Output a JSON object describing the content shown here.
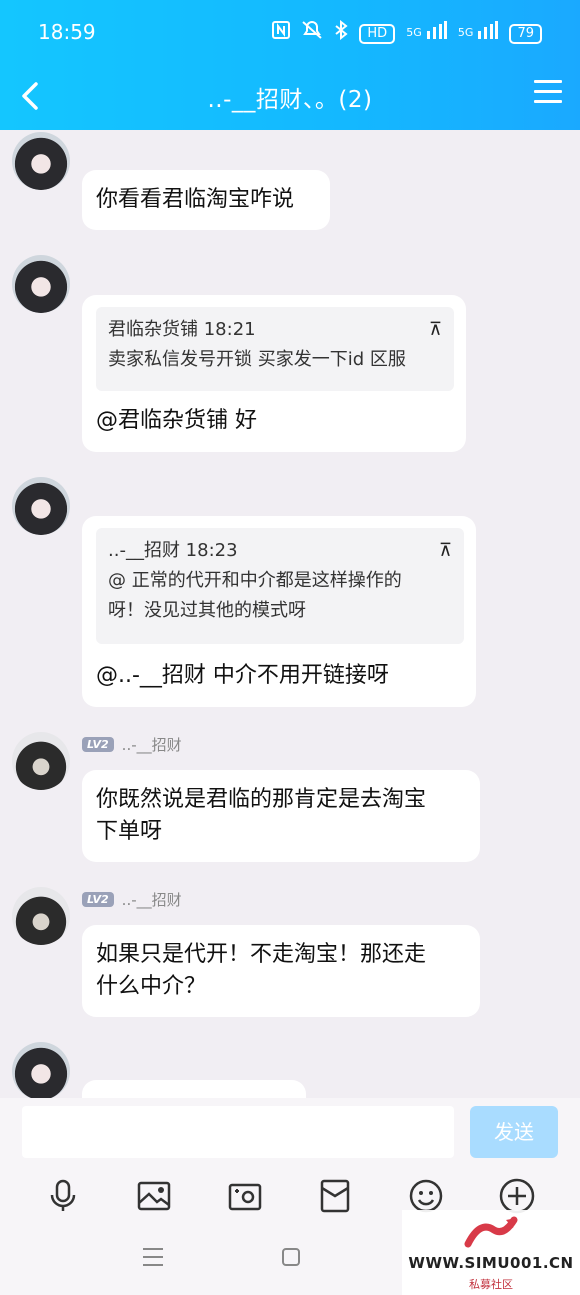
{
  "status_bar": {
    "time": "18:59",
    "icons": [
      "nfc-icon",
      "mute-icon",
      "bluetooth-icon",
      "hd-icon",
      "signal-5g-icon",
      "signal-5g-icon"
    ],
    "hd_label": "HD",
    "net1": "5G",
    "net2": "5G",
    "battery": "79"
  },
  "header": {
    "title": "..-__招财、。(2)"
  },
  "messages": [
    {
      "sender": "",
      "text": "你看看君临淘宝咋说"
    },
    {
      "sender": "",
      "quote": {
        "author_time": "君临杂货铺 18:21",
        "text": "卖家私信发号开锁 买家发一下id 区服"
      },
      "text": "@君临杂货铺 好"
    },
    {
      "sender": "",
      "quote": {
        "author_time": "..-__招财 18:23",
        "line1": "@ 正常的代开和中介都是这样操作的",
        "line2": "呀！没见过其他的模式呀"
      },
      "text": "@..-__招财 中介不用开链接呀"
    },
    {
      "level": "LV2",
      "sender": "..-__招财",
      "line1": "你既然说是君临的那肯定是去淘宝",
      "line2": "下单呀"
    },
    {
      "level": "LV2",
      "sender": "..-__招财",
      "line1": "如果只是代开！不走淘宝！那还走",
      "line2": "什么中介？"
    }
  ],
  "input": {
    "value": "",
    "send_label": "发送"
  },
  "toolbar": [
    "microphone-icon",
    "image-icon",
    "camera-icon",
    "red-packet-icon",
    "emoji-icon",
    "plus-icon"
  ],
  "watermark": {
    "url": "WWW.SIMU001.CN",
    "sub": "私募社区"
  },
  "colors": {
    "header_start": "#14c6ff",
    "header_end": "#1aa9ff",
    "send_disabled": "#a9dcff",
    "background": "#f1eef3"
  }
}
